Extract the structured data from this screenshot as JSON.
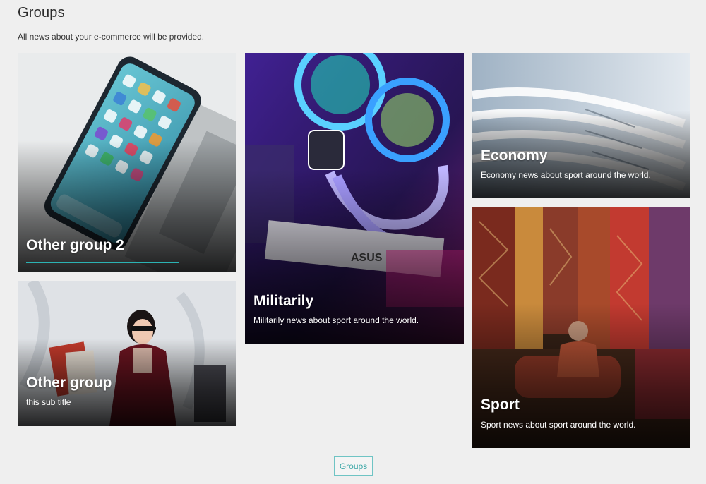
{
  "header": {
    "title": "Groups",
    "subtitle": "All news about your e-commerce will be provided."
  },
  "cards": {
    "other_group_2": {
      "title": "Other group 2"
    },
    "other_group": {
      "title": "Other group",
      "subtitle": "this sub title"
    },
    "militarily": {
      "title": "Militarily",
      "subtitle": "Militarily news about sport around the world."
    },
    "economy": {
      "title": "Economy",
      "subtitle": "Economy news about sport around the world."
    },
    "sport": {
      "title": "Sport",
      "subtitle": "Sport news about sport around the world."
    }
  },
  "footer": {
    "button_label": "Groups"
  },
  "colors": {
    "accent": "#2bb3b3",
    "background": "#efefef"
  }
}
